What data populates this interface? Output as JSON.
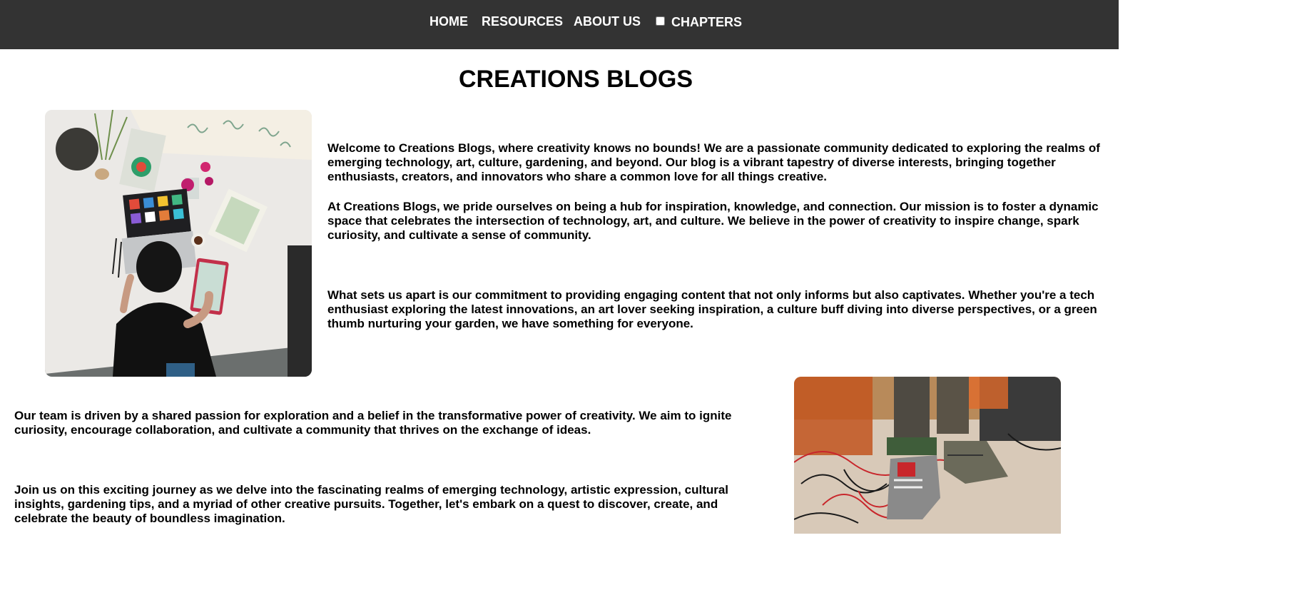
{
  "nav": {
    "home": "HOME",
    "resources": "RESOURCES",
    "about": "ABOUT US",
    "chapters": "CHAPTERS",
    "chapters_checked": false
  },
  "title": "CREATIONS BLOGS",
  "section1": {
    "paragraphs": [
      "Welcome to Creations Blogs, where creativity knows no bounds! We are a passionate community dedicated to exploring the realms of emerging technology, art, culture, gardening, and beyond. Our blog is a vibrant tapestry of diverse interests, bringing together enthusiasts, creators, and innovators who share a common love for all things creative.",
      "At Creations Blogs, we pride ourselves on being a hub for inspiration, knowledge, and connection. Our mission is to foster a dynamic space that celebrates the intersection of technology, art, and culture. We believe in the power of creativity to inspire change, spark curiosity, and cultivate a sense of community.",
      "What sets us apart is our commitment to providing engaging content that not only informs but also captivates. Whether you're a tech enthusiast exploring the latest innovations, an art lover seeking inspiration, a culture buff diving into diverse perspectives, or a green thumb nurturing your garden, we have something for everyone."
    ]
  },
  "section2": {
    "paragraphs": [
      "Our team is driven by a shared passion for exploration and a belief in the transformative power of creativity. We aim to ignite curiosity, encourage collaboration, and cultivate a community that thrives on the exchange of ideas.",
      "Join us on this exciting journey as we delve into the fascinating realms of emerging technology, artistic expression, cultural insights, gardening tips, and a myriad of other creative pursuits. Together, let's embark on a quest to discover, create, and celebrate the beauty of boundless imagination."
    ]
  },
  "colors": {
    "navbar_bg": "#333333",
    "nav_text": "#ffffff",
    "page_bg": "#ffffff"
  }
}
